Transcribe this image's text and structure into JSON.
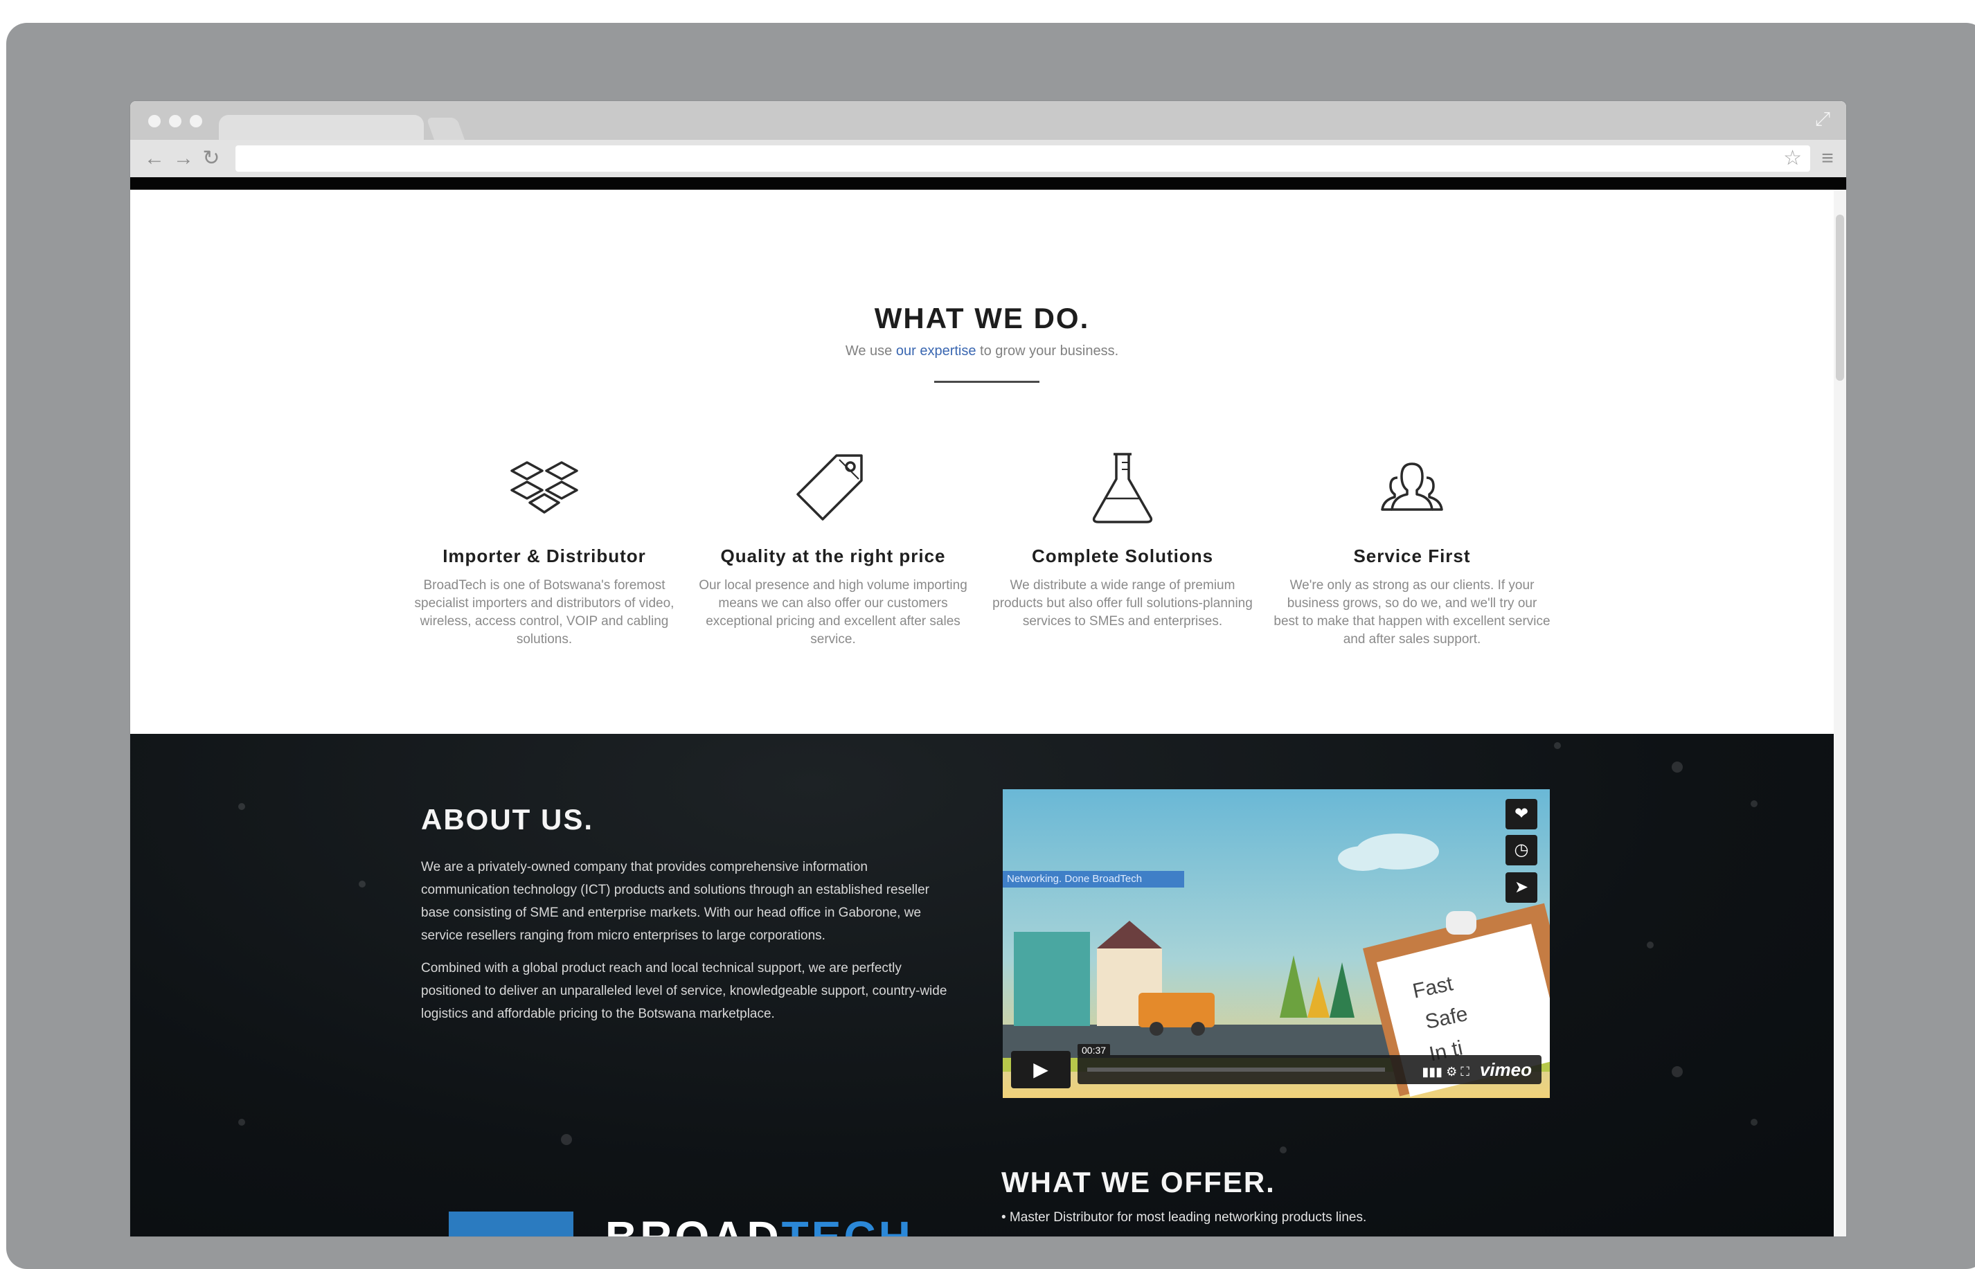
{
  "what_we_do": {
    "title": "WHAT WE DO.",
    "subtitle_pre": "We use ",
    "subtitle_link": "our expertise",
    "subtitle_post": " to grow your business.",
    "features": [
      {
        "title": "Importer & Distributor",
        "text": "BroadTech is one of Botswana's foremost specialist importers and distributors of video, wireless, access control, VOIP and cabling solutions.",
        "icon": "dropbox-boxes-icon"
      },
      {
        "title": "Quality at the right price",
        "text": "Our local presence and high volume importing means we can also offer our customers exceptional pricing and excellent after sales service.",
        "icon": "price-tag-icon"
      },
      {
        "title": "Complete Solutions",
        "text": "We distribute a wide range of premium products but also offer full solutions-planning services to SMEs and enterprises.",
        "icon": "flask-icon"
      },
      {
        "title": "Service First",
        "text": "We're only as strong as our clients. If your business grows, so do we, and we'll try our best to make that happen with excellent service and after sales support.",
        "icon": "users-icon"
      }
    ]
  },
  "about": {
    "title": "ABOUT US.",
    "paragraphs": [
      "We are a privately-owned company that provides comprehensive information communication technology (ICT) products and solutions through an established reseller base consisting of SME and enterprise markets. With our head office in Gaborone, we service resellers ranging from micro enterprises to large corporations.",
      "Combined with a global product reach and local technical support, we are perfectly positioned to deliver an unparalleled level of service, knowledgeable support, country-wide logistics and affordable pricing to the Botswana marketplace."
    ]
  },
  "video": {
    "banner": "Networking. Done BroadTech",
    "time": "00:37",
    "brand": "vimeo",
    "clipboard_items": [
      "Fast",
      "Safe",
      "In ti"
    ]
  },
  "offer": {
    "title": "WHAT WE OFFER.",
    "items": [
      "• Master Distributor for most leading networking products lines."
    ]
  },
  "logo": {
    "part1": "BROAD",
    "part2": "TECH"
  },
  "colors": {
    "accent": "#3a67b1",
    "dark_bg": "#0e1215",
    "brand_blue": "#2b88d8"
  }
}
